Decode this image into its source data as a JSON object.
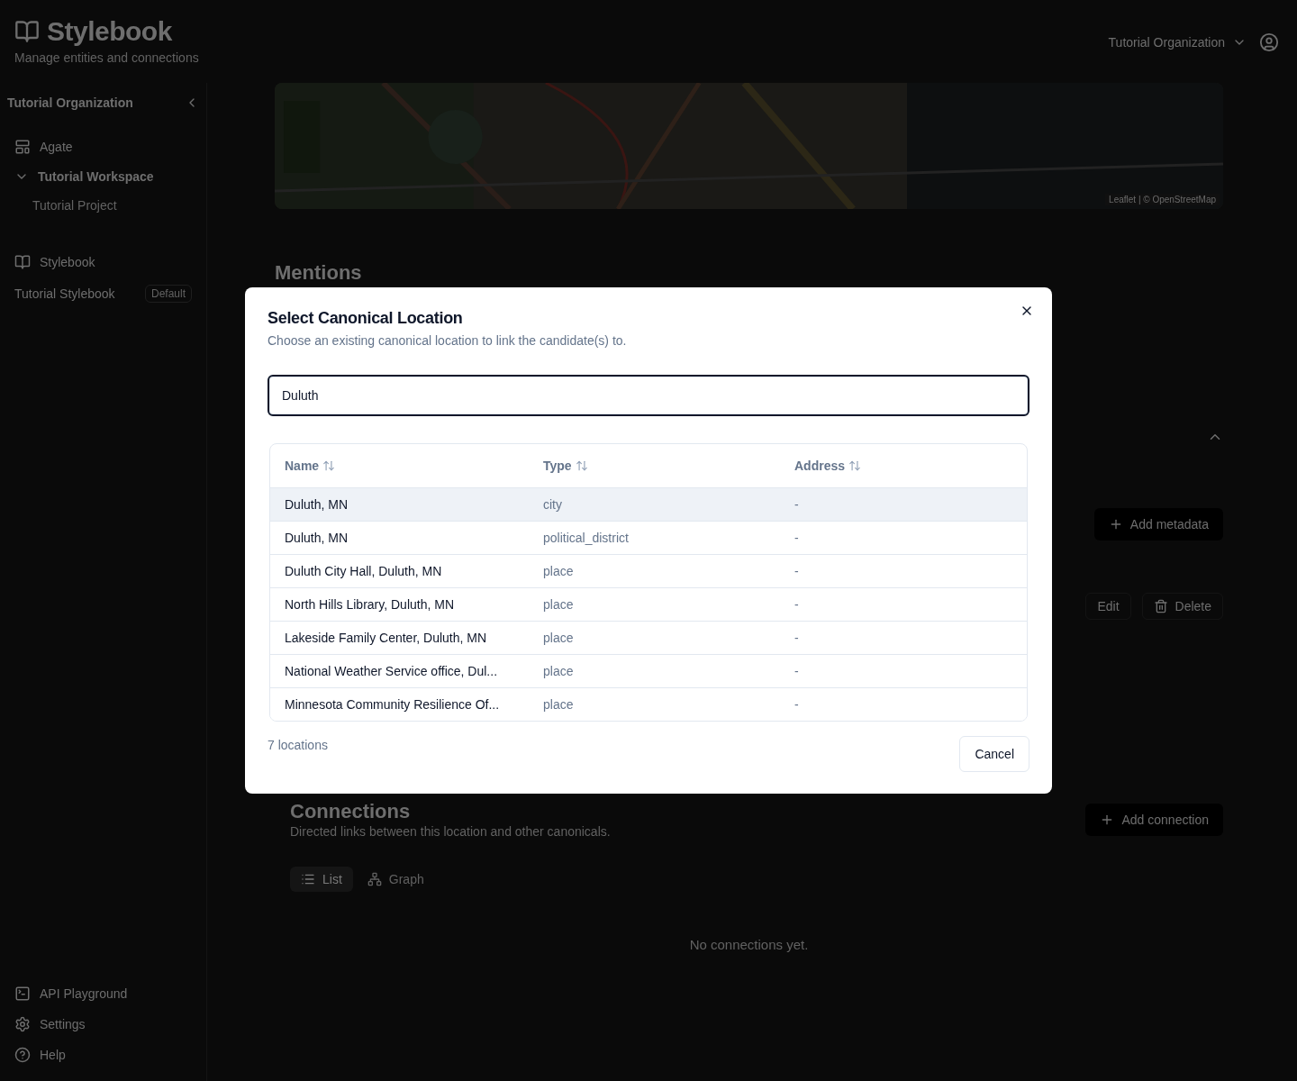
{
  "app": {
    "title": "Stylebook",
    "subtitle": "Manage entities and connections",
    "org_selector": "Tutorial Organization"
  },
  "sidebar": {
    "org": "Tutorial Organization",
    "items": [
      {
        "kind": "app",
        "label": "Agate"
      },
      {
        "kind": "folder",
        "label": "Tutorial Workspace",
        "expanded": true,
        "children": [
          {
            "label": "Tutorial Project"
          }
        ]
      },
      {
        "kind": "app",
        "label": "Stylebook"
      },
      {
        "kind": "stylebook",
        "label": "Tutorial Stylebook",
        "badge": "Default"
      }
    ],
    "footer": [
      {
        "kind": "terminal",
        "label": "API Playground"
      },
      {
        "kind": "settings",
        "label": "Settings"
      },
      {
        "kind": "help",
        "label": "Help"
      }
    ]
  },
  "main": {
    "map_attribution": "Leaflet | © OpenStreetMap",
    "mentions_title": "Mentions",
    "add_metadata": "Add metadata",
    "edit": "Edit",
    "delete": "Delete",
    "connections": {
      "title": "Connections",
      "subtitle": "Directed links between this location and other canonicals.",
      "add": "Add connection",
      "tabs": [
        {
          "label": "List",
          "kind": "list",
          "selected": true
        },
        {
          "label": "Graph",
          "kind": "graph",
          "selected": false
        }
      ],
      "empty": "No connections yet."
    }
  },
  "dialog": {
    "title": "Select Canonical Location",
    "description": "Choose an existing canonical location to link the candidate(s) to.",
    "search_value": "Duluth",
    "columns": [
      "Name",
      "Type",
      "Address"
    ],
    "rows": [
      {
        "name": "Duluth, MN",
        "type": "city",
        "address": "-",
        "selected": true
      },
      {
        "name": "Duluth, MN",
        "type": "political_district",
        "address": "-",
        "selected": false
      },
      {
        "name": "Duluth City Hall, Duluth, MN",
        "type": "place",
        "address": "-",
        "selected": false
      },
      {
        "name": "North Hills Library, Duluth, MN",
        "type": "place",
        "address": "-",
        "selected": false
      },
      {
        "name": "Lakeside Family Center, Duluth, MN",
        "type": "place",
        "address": "-",
        "selected": false
      },
      {
        "name": "National Weather Service office, Dul...",
        "type": "place",
        "address": "-",
        "selected": false
      },
      {
        "name": "Minnesota Community Resilience Of...",
        "type": "place",
        "address": "-",
        "selected": false
      }
    ],
    "count": "7 locations",
    "cancel": "Cancel"
  }
}
